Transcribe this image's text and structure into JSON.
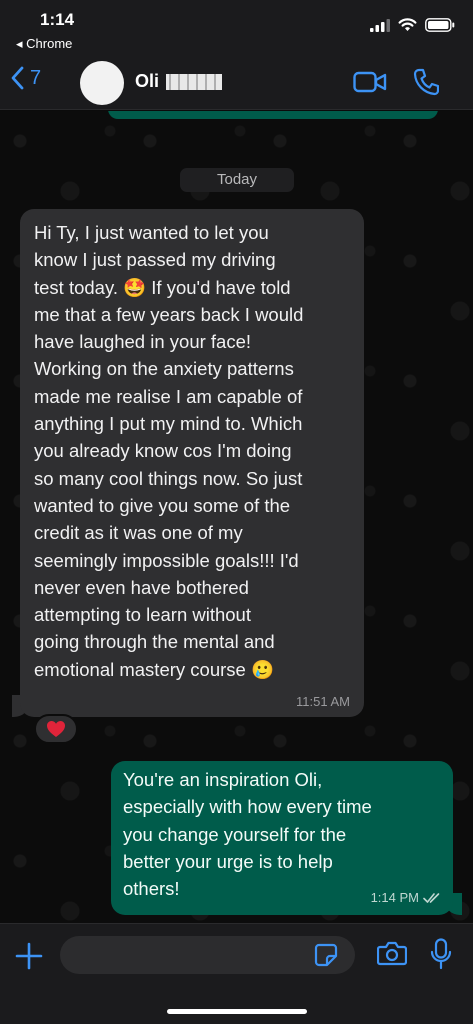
{
  "status_bar": {
    "time": "1:14",
    "back_app": "◂ Chrome"
  },
  "header": {
    "back_count": "7",
    "contact_name": "Oli"
  },
  "chat": {
    "date_label": "Today",
    "incoming": {
      "text": "Hi Ty, I just wanted to let you\nknow I just passed my driving\ntest today. 🤩 If you'd have told\nme that a few years back I would\nhave laughed in your face!\nWorking on the anxiety patterns\nmade me realise I am capable of\nanything I put my mind to. Which\nyou already know cos I'm doing\nso many cool things now. So just\nwanted to give you some of the\ncredit as it was one of my\nseemingly impossible goals!!! I'd\nnever even have bothered\nattempting to learn without\ngoing through the mental and\nemotional mastery course 🥲",
      "time": "11:51 AM",
      "reaction": "heart"
    },
    "outgoing": {
      "text": "You're an inspiration Oli,\nespecially with how every time\nyou change yourself for the\nbetter your urge is to help\nothers!",
      "time": "1:14 PM",
      "status": "read"
    }
  },
  "input": {
    "placeholder": ""
  },
  "colors": {
    "accent": "#3d93f5",
    "incoming_bubble": "#2f2f31",
    "outgoing_bubble": "#005c4b",
    "reaction_heart": "#e0243a"
  },
  "icons": {
    "status": [
      "signal-icon",
      "wifi-icon",
      "battery-icon"
    ],
    "header": [
      "chevron-left-icon",
      "video-camera-icon",
      "phone-icon"
    ],
    "input": [
      "plus-icon",
      "sticker-icon",
      "camera-icon",
      "microphone-icon"
    ],
    "message": [
      "double-check-icon",
      "heart-icon"
    ]
  }
}
